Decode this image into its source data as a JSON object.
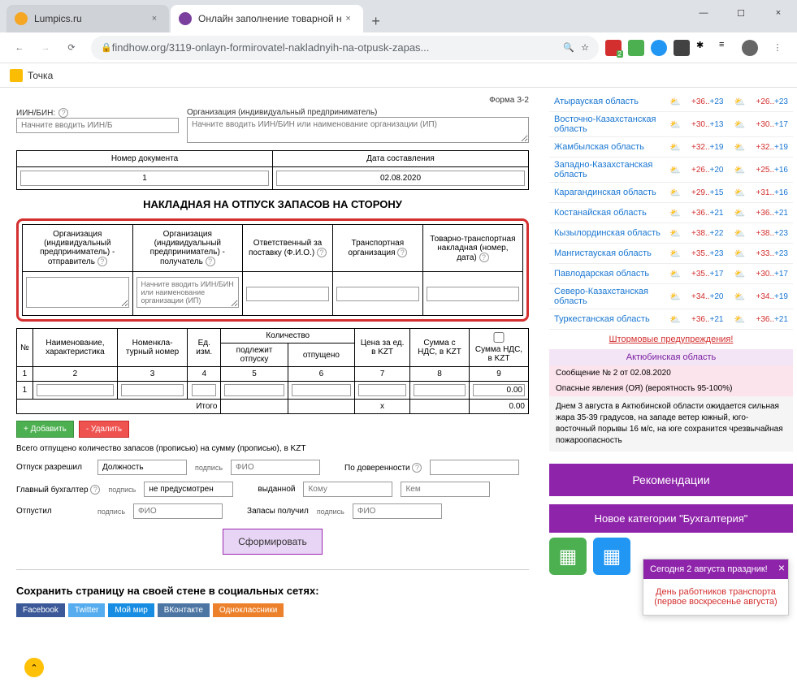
{
  "browser": {
    "tab1": "Lumpics.ru",
    "tab2": "Онлайн заполнение товарной н",
    "url": "findhow.org/3119-onlayn-formirovatel-nakladnyih-na-otpusk-zapas...",
    "bookmark": "Точка"
  },
  "form": {
    "form_num": "Форма З-2",
    "iin_label": "ИИН/БИН:",
    "iin_placeholder": "Начните вводить ИИН/Б",
    "org_label": "Организация (индивидуальный предприниматель)",
    "org_placeholder": "Начните вводить ИИН/БИН или наименование организации (ИП)",
    "doc_num_label": "Номер документа",
    "doc_num_val": "1",
    "doc_date_label": "Дата составления",
    "doc_date_val": "02.08.2020",
    "title": "НАКЛАДНАЯ НА ОТПУСК ЗАПАСОВ НА СТОРОНУ",
    "headers": {
      "sender": "Организация (индивидуальный предприниматель) - отправитель",
      "receiver": "Организация (индивидуальный предприниматель) - получатель",
      "responsible": "Ответственный за поставку (Ф.И.О.)",
      "transport_org": "Транспортная организация",
      "ttn": "Товарно-транспортная накладная (номер, дата)"
    },
    "receiver_placeholder": "Начните вводить ИИН/БИН или наименование организации (ИП)",
    "items_headers": {
      "num": "№",
      "name": "Наименование, характеристика",
      "nomen": "Номенкла-турный номер",
      "unit": "Ед. изм.",
      "qty": "Количество",
      "qty_req": "подлежит отпуску",
      "qty_rel": "отпущено",
      "price": "Цена за ед. в KZT",
      "sum": "Сумма с НДС, в KZT",
      "nds": "Сумма НДС, в KZT"
    },
    "row_nums": [
      "1",
      "2",
      "3",
      "4",
      "5",
      "6",
      "7",
      "8",
      "9"
    ],
    "row1": "1",
    "itogo": "Итого",
    "x": "x",
    "zero": "0.00",
    "btn_add": "+ Добавить",
    "btn_del": "- Удалить",
    "footer_text": "Всего отпущено количество запасов (прописью) на сумму (прописью), в KZT",
    "sig": {
      "allowed": "Отпуск разрешил",
      "position": "Должность",
      "sign": "подпись",
      "fio": "ФИО",
      "accountant": "Главный бухгалтер",
      "released": "Отпустил",
      "by_proxy": "По доверенности",
      "issued": "выданной",
      "received": "Запасы получил",
      "not_provided": "не предусмотрен",
      "komu": "Кому",
      "kem": "Кем"
    },
    "submit": "Сформировать",
    "social_title": "Сохранить страницу на своей стене в социальных сетях:",
    "social": {
      "fb": "Facebook",
      "tw": "Twitter",
      "mm": "Мой мир",
      "vk": "ВКонтакте",
      "ok": "Одноклассники"
    }
  },
  "weather": [
    {
      "name": "Атырауская область",
      "t1h": "+36..",
      "t1l": "+23",
      "t2h": "+26..",
      "t2l": "+23"
    },
    {
      "name": "Восточно-Казахстанская область",
      "t1h": "+30..",
      "t1l": "+13",
      "t2h": "+30..",
      "t2l": "+17"
    },
    {
      "name": "Жамбылская область",
      "t1h": "+32..",
      "t1l": "+19",
      "t2h": "+32..",
      "t2l": "+19"
    },
    {
      "name": "Западно-Казахстанская область",
      "t1h": "+26..",
      "t1l": "+20",
      "t2h": "+25..",
      "t2l": "+16"
    },
    {
      "name": "Карагандинская область",
      "t1h": "+29..",
      "t1l": "+15",
      "t2h": "+31..",
      "t2l": "+16"
    },
    {
      "name": "Костанайская область",
      "t1h": "+36..",
      "t1l": "+21",
      "t2h": "+36..",
      "t2l": "+21"
    },
    {
      "name": "Кызылординская область",
      "t1h": "+38..",
      "t1l": "+22",
      "t2h": "+38..",
      "t2l": "+23"
    },
    {
      "name": "Мангистауская область",
      "t1h": "+35..",
      "t1l": "+23",
      "t2h": "+33..",
      "t2l": "+23"
    },
    {
      "name": "Павлодарская область",
      "t1h": "+35..",
      "t1l": "+17",
      "t2h": "+30..",
      "t2l": "+17"
    },
    {
      "name": "Северо-Казахстанская область",
      "t1h": "+34..",
      "t1l": "+20",
      "t2h": "+34..",
      "t2l": "+19"
    },
    {
      "name": "Туркестанская область",
      "t1h": "+36..",
      "t1l": "+21",
      "t2h": "+36..",
      "t2l": "+21"
    }
  ],
  "warn": {
    "link": "Штормовые предупреждения!",
    "region": "Актюбинская область",
    "msg": "Сообщение № 2 от 02.08.2020",
    "detail_h": "Опасные явления (ОЯ) (вероятность 95-100%)",
    "detail": "Днем 3 августа в Актюбинской области ожидается сильная жара 35-39 градусов, на западе ветер южный, юго-восточный порывы 16 м/с, на юге сохранится чрезвычайная пожароопасность"
  },
  "rec": "Рекомендации",
  "newcat": "Новое категории \"Бухгалтерия\"",
  "holiday": {
    "head": "Сегодня 2 августа праздник!",
    "body": "День работников транспорта (первое воскресенье августа)"
  }
}
